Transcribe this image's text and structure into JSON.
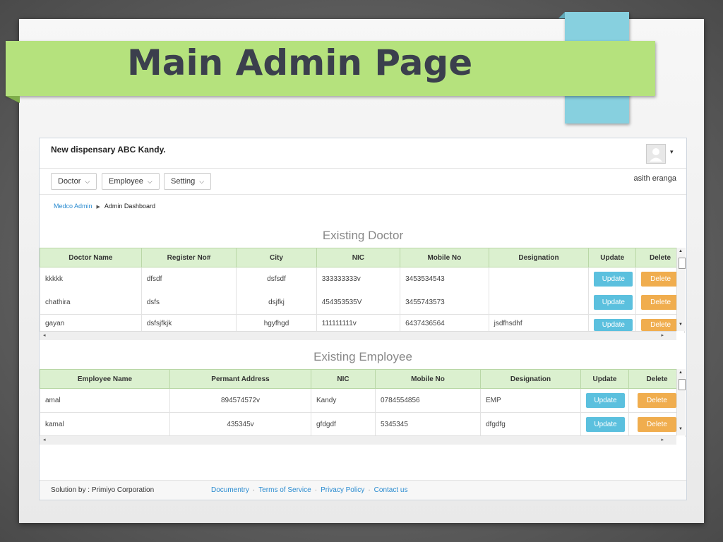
{
  "slide": {
    "title": "Main Admin Page"
  },
  "app": {
    "brand": "New dispensary ABC Kandy.",
    "username": "asith eranga",
    "caret": "▾",
    "nav": [
      {
        "label": "Doctor"
      },
      {
        "label": "Employee"
      },
      {
        "label": "Setting"
      }
    ],
    "breadcrumb": {
      "root": "Medco Admin",
      "current": "Admin Dashboard"
    }
  },
  "doctor_table": {
    "title": "Existing Doctor",
    "headers": [
      "Doctor Name",
      "Register No#",
      "City",
      "NIC",
      "Mobile No",
      "Designation",
      "Update",
      "Delete"
    ],
    "rows": [
      {
        "name": "kkkkk",
        "reg": "dfsdf",
        "city": "dsfsdf",
        "nic": "333333333v",
        "mobile": "3453534543",
        "designation": ""
      },
      {
        "name": "chathira",
        "reg": "dsfs",
        "city": "dsjfkj",
        "nic": "454353535V",
        "mobile": "3455743573",
        "designation": ""
      },
      {
        "name": "gayan",
        "reg": "dsfsjfkjk",
        "city": "hgyfhgd",
        "nic": "111111111v",
        "mobile": "6437436564",
        "designation": "jsdfhsdhf"
      }
    ]
  },
  "employee_table": {
    "title": "Existing Employee",
    "headers": [
      "Employee Name",
      "Permant Address",
      "NIC",
      "Mobile No",
      "Designation",
      "Update",
      "Delete"
    ],
    "rows": [
      {
        "name": "amal",
        "address": "894574572v",
        "nic": "Kandy",
        "mobile": "0784554856",
        "designation": "EMP"
      },
      {
        "name": "kamal",
        "address": "435345v",
        "nic": "gfdgdf",
        "mobile": "5345345",
        "designation": "dfgdfg"
      }
    ]
  },
  "buttons": {
    "update": "Update",
    "delete": "Delete"
  },
  "footer": {
    "solution": "Solution by : Primiyo Corporation",
    "links": [
      "Documentry",
      "Terms of Service",
      "Privacy Policy",
      "Contact us"
    ],
    "separator": "·"
  },
  "icons": {
    "chevron": "chevron-down-icon",
    "breadcrumb_sep": "caret-right-icon",
    "avatar": "user-avatar-icon"
  },
  "colors": {
    "banner": "#b5e27d",
    "accent_tab": "#87d0df",
    "table_header": "#dbf0cf",
    "update_btn": "#5bc0de",
    "delete_btn": "#f0ad4e",
    "link": "#2a8bd0"
  }
}
